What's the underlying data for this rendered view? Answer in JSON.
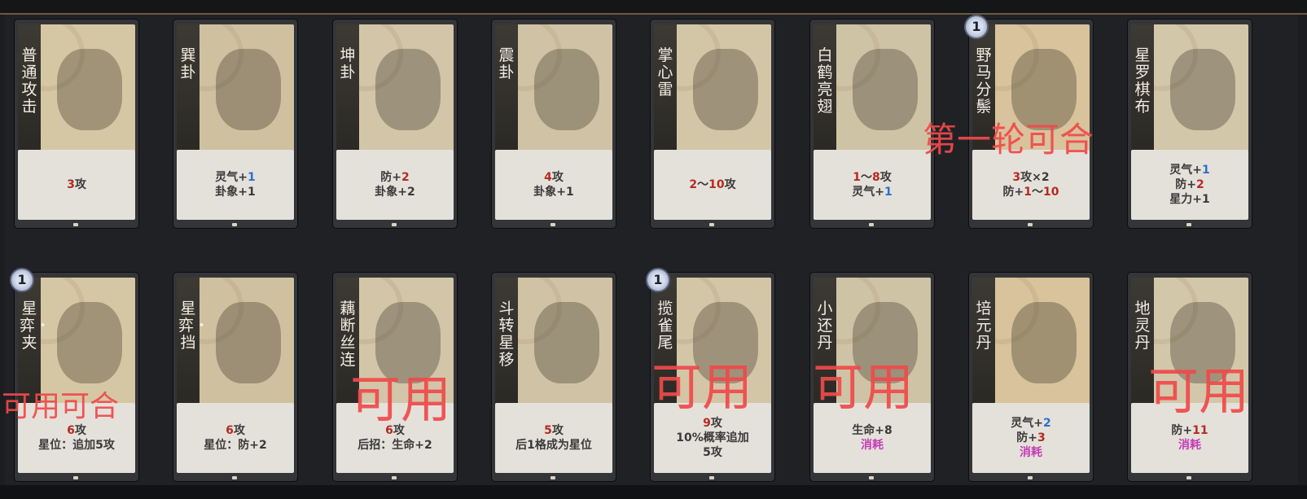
{
  "cards_row1": [
    {
      "name": "普通攻击",
      "desc": [
        [
          {
            "t": "3",
            "c": "red"
          },
          {
            "t": "攻"
          }
        ]
      ]
    },
    {
      "name": "巽卦",
      "desc": [
        [
          {
            "t": "灵气+"
          },
          {
            "t": "1",
            "c": "blue"
          }
        ],
        [
          {
            "t": "卦象+1"
          }
        ]
      ]
    },
    {
      "name": "坤卦",
      "desc": [
        [
          {
            "t": "防+"
          },
          {
            "t": "2",
            "c": "red"
          }
        ],
        [
          {
            "t": "卦象+2"
          }
        ]
      ]
    },
    {
      "name": "震卦",
      "desc": [
        [
          {
            "t": "4",
            "c": "red"
          },
          {
            "t": "攻"
          }
        ],
        [
          {
            "t": "卦象+1"
          }
        ]
      ]
    },
    {
      "name": "掌心雷",
      "desc": [
        [
          {
            "t": "2",
            "c": "red"
          },
          {
            "t": "〜"
          },
          {
            "t": "10",
            "c": "red"
          },
          {
            "t": "攻"
          }
        ]
      ]
    },
    {
      "name": "白鹤亮翅",
      "desc": [
        [
          {
            "t": "1",
            "c": "red"
          },
          {
            "t": "〜"
          },
          {
            "t": "8",
            "c": "red"
          },
          {
            "t": "攻"
          }
        ],
        [
          {
            "t": "灵气+"
          },
          {
            "t": "1",
            "c": "blue"
          }
        ]
      ]
    },
    {
      "name": "野马分鬃",
      "badge": "1",
      "desc": [
        [
          {
            "t": "3",
            "c": "red"
          },
          {
            "t": "攻×2"
          }
        ],
        [
          {
            "t": "防+"
          },
          {
            "t": "1",
            "c": "red"
          },
          {
            "t": "〜"
          },
          {
            "t": "10",
            "c": "red"
          }
        ]
      ]
    },
    {
      "name": "星罗棋布",
      "desc": [
        [
          {
            "t": "灵气+"
          },
          {
            "t": "1",
            "c": "blue"
          }
        ],
        [
          {
            "t": "防+"
          },
          {
            "t": "2",
            "c": "red"
          }
        ],
        [
          {
            "t": "星力+1"
          }
        ]
      ]
    }
  ],
  "cards_row2": [
    {
      "name": "星弈・夹",
      "badge": "1",
      "desc": [
        [
          {
            "t": "6",
            "c": "red"
          },
          {
            "t": "攻"
          }
        ],
        [
          {
            "t": "星位：追加5攻"
          }
        ]
      ]
    },
    {
      "name": "星弈・挡",
      "desc": [
        [
          {
            "t": "6",
            "c": "red"
          },
          {
            "t": "攻"
          }
        ],
        [
          {
            "t": "星位：防+2"
          }
        ]
      ]
    },
    {
      "name": "藕断丝连",
      "desc": [
        [
          {
            "t": "6",
            "c": "red"
          },
          {
            "t": "攻"
          }
        ],
        [
          {
            "t": "后招：生命+2"
          }
        ]
      ]
    },
    {
      "name": "斗转星移",
      "desc": [
        [
          {
            "t": "5",
            "c": "red"
          },
          {
            "t": "攻"
          }
        ],
        [
          {
            "t": "后1格成为星位"
          }
        ]
      ]
    },
    {
      "name": "揽雀尾",
      "badge": "1",
      "desc": [
        [
          {
            "t": "9",
            "c": "red"
          },
          {
            "t": "攻"
          }
        ],
        [
          {
            "t": "10%概率追加"
          }
        ],
        [
          {
            "t": "5攻"
          }
        ]
      ]
    },
    {
      "name": "小还丹",
      "desc": [
        [
          {
            "t": "生命+8"
          }
        ],
        [
          {
            "t": "消耗",
            "c": "purple"
          }
        ]
      ]
    },
    {
      "name": "培元丹",
      "desc": [
        [
          {
            "t": "灵气+"
          },
          {
            "t": "2",
            "c": "blue"
          }
        ],
        [
          {
            "t": "防+"
          },
          {
            "t": "3",
            "c": "red"
          }
        ],
        [
          {
            "t": "消耗",
            "c": "purple"
          }
        ]
      ]
    },
    {
      "name": "地灵丹",
      "desc": [
        [
          {
            "t": "防+"
          },
          {
            "t": "11",
            "c": "red"
          }
        ],
        [
          {
            "t": "消耗",
            "c": "purple"
          }
        ]
      ]
    }
  ],
  "annotations": [
    {
      "text": "第一轮可合"
    },
    {
      "text": "可用可合"
    },
    {
      "text": "可用"
    },
    {
      "text": "可用"
    },
    {
      "text": "可用"
    },
    {
      "text": "可用"
    }
  ]
}
